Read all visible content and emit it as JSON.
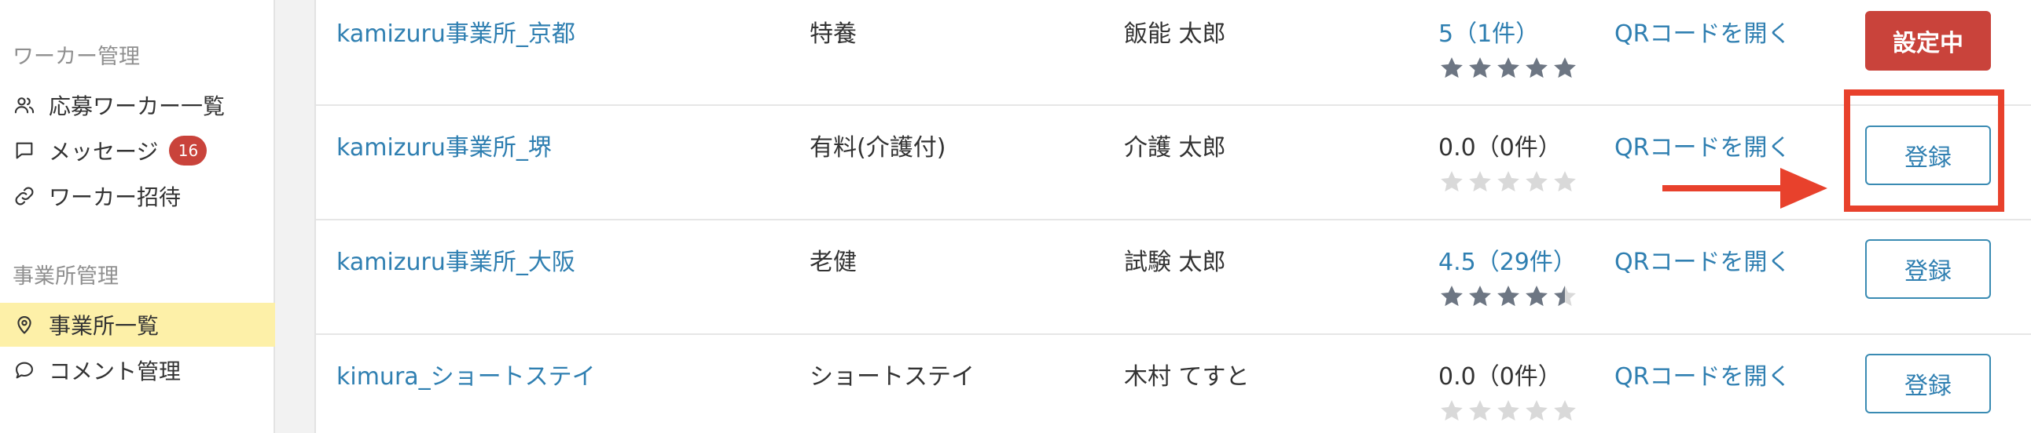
{
  "sidebar": {
    "worker_section": "ワーカー管理",
    "worker_items": [
      {
        "label": "応募ワーカー一覧",
        "icon": "users-icon"
      },
      {
        "label": "メッセージ",
        "icon": "message-icon",
        "badge": "16"
      },
      {
        "label": "ワーカー招待",
        "icon": "link-icon"
      }
    ],
    "office_section": "事業所管理",
    "office_items": [
      {
        "label": "事業所一覧",
        "icon": "map-pin-icon",
        "active": true
      },
      {
        "label": "コメント管理",
        "icon": "comment-icon"
      }
    ]
  },
  "table": {
    "rows": [
      {
        "name": "kamizuru事業所_京都",
        "type": "特養",
        "person": "飯能 太郎",
        "rating": "5（1件）",
        "rating_value": 5,
        "rating_linked": true,
        "qr": "QRコードを開く",
        "action": "設定中",
        "action_style": "filled"
      },
      {
        "name": "kamizuru事業所_堺",
        "type": "有料(介護付)",
        "person": "介護 太郎",
        "rating": "0.0（0件）",
        "rating_value": 0,
        "rating_linked": false,
        "qr": "QRコードを開く",
        "action": "登録",
        "action_style": "outline"
      },
      {
        "name": "kamizuru事業所_大阪",
        "type": "老健",
        "person": "試験 太郎",
        "rating": "4.5（29件）",
        "rating_value": 4.5,
        "rating_linked": true,
        "qr": "QRコードを開く",
        "action": "登録",
        "action_style": "outline"
      },
      {
        "name": "kimura_ショートステイ",
        "type": "ショートステイ",
        "person": "木村 てすと",
        "rating": "0.0（0件）",
        "rating_value": 0,
        "rating_linked": false,
        "qr": "QRコードを開く",
        "action": "登録",
        "action_style": "outline"
      }
    ]
  },
  "colors": {
    "link": "#2f7fb1",
    "danger": "#c9433b",
    "active_nav": "#fdf0a8",
    "star_filled": "#6d7683",
    "star_empty": "#d9d9d9",
    "annotation": "#e8412c"
  }
}
